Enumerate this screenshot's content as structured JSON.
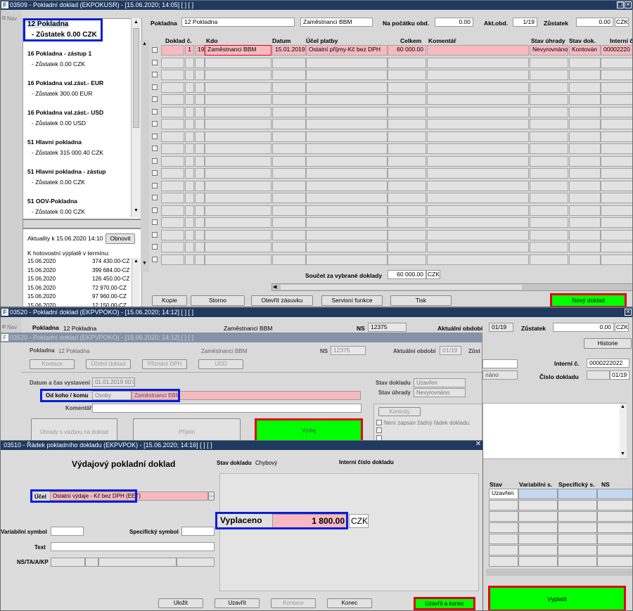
{
  "win1": {
    "title": "03509 - Pokladní doklad (EKPOKUSR) - [15.06.2020; 14:05]  [ ]  [ ]",
    "nav": "Nav",
    "pokladny": [
      {
        "name": "12 Pokladna",
        "balance": "- Zůstatek 0.00 CZK"
      },
      {
        "name": "16 Pokladna - zástup 1",
        "balance": "- Zůstatek 0.00 CZK"
      },
      {
        "name": "16 Pokladna val.zást.- EUR",
        "balance": "- Zůstatek 300.00 EUR"
      },
      {
        "name": "16 Pokladna val.zást.- USD",
        "balance": "- Zůstatek 0.00 USD"
      },
      {
        "name": "51 Hlavní pokladna",
        "balance": "- Zůstatek 315 000.40 CZK"
      },
      {
        "name": "51 Hlavní pokladna - zástup",
        "balance": "- Zůstatek 0.00 CZK"
      },
      {
        "name": "51 OOV-Pokladna",
        "balance": "- Zůstatek 0.00 CZK"
      }
    ],
    "aktuality": "Aktuality k 15.06.2020 14:10",
    "obnovit": "Obnovit",
    "vyplate_title": "K hotovostní výplatě v termínu:",
    "vyplate": [
      {
        "date": "15.06.2020",
        "amount": "374 430.00-CZ"
      },
      {
        "date": "15.06.2020",
        "amount": "399 684.00-CZ"
      },
      {
        "date": "15.06.2020",
        "amount": "126 450.00-CZ"
      },
      {
        "date": "15.06.2020",
        "amount": "72 970.00-CZ"
      },
      {
        "date": "15.06.2020",
        "amount": "97 960.00-CZ"
      },
      {
        "date": "15.06.2020",
        "amount": "12 150.00-CZ"
      }
    ],
    "top": {
      "pokladna_label": "Pokladna",
      "pokladna_value": "12 Pokladna",
      "zam_value": "Zaměstnanci BBM",
      "napoc_label": "Na počátku obd.",
      "napoc_value": "0.00",
      "aktobd_label": "Akt.obd.",
      "aktobd_value": "1/19",
      "zustatek_label": "Zůstatek",
      "zustatek_value": "0.00",
      "currency": "CZK"
    },
    "columns": [
      "Doklad č.",
      "Kdo",
      "Datum",
      "Účel platby",
      "Celkem",
      "Komentář",
      "Stav úhrady",
      "Stav dok.",
      "Interní č"
    ],
    "row": {
      "d1": "1",
      "d2": "19",
      "kdo": "Zaměstnanci BBM",
      "datum": "15.01.2019",
      "ucel": "Ostatní příjmy-Kč bez DPH",
      "celkem": "60 000.00",
      "komentar": "",
      "stav_uhrady": "Nevyrovnáno",
      "stav_dok": "Kontován",
      "interni": "00002220"
    },
    "soucet_label": "Součet za vybrané doklady",
    "soucet_value": "60 000.00",
    "soucet_currency": "CZK",
    "buttons": {
      "kopie": "Kopie",
      "storno": "Storno",
      "zasuvka": "Otevřít zásuvku",
      "servis": "Servisní funkce",
      "tisk": "Tisk",
      "novy": "Nový doklad"
    }
  },
  "win2": {
    "title": "03520 - Pokladní doklad (EKPVPOKO) - [15.06.2020; 14:12]  [ ]  [ ]",
    "nav": "Nav",
    "pokladna_label": "Pokladna",
    "pokladna_value": "12 Pokladna",
    "zam_value": "Zaměstnanci BBM",
    "ns_label": "NS",
    "ns_value": "12375",
    "akt_label": "Aktuální období",
    "akt_value": "01/19",
    "zustatek_label": "Zůstatek",
    "zustatek_value": "0.00",
    "currency": "CZK",
    "historie": "Historie",
    "interni_label": "Interní č.",
    "interni_value": "0000222022",
    "cislo_label": "Číslo dokladu",
    "cislo_value": "01/19",
    "grid_headers": [
      "Stav",
      "Variabilní s.",
      "Specifický s.",
      "NS"
    ],
    "grid_stav": "Uzavřen",
    "vyplatit": "Vyplatit"
  },
  "ghost": {
    "title": "03520 - Pokladní doklad (EKPVPOKO) - [15.06.2020; 14:12]  [ ]  [ ]",
    "pokladna_label": "Pokladna",
    "pokladna_value": "12 Pokladna",
    "zam_value": "Zaměstnanci BBM",
    "ns_label": "NS",
    "ns_value": "12375",
    "akt_label": "Aktuální období",
    "akt_value": "01/19",
    "zus_label": "Zůst",
    "tabs": [
      "Kontace",
      "Účetní doklad",
      "Přiznání DPH",
      "UDD"
    ],
    "datum_label": "Datum a čas vystavení",
    "datum_value": "01.01.2019 00:00",
    "odkoho_label": "Od koho / komu",
    "osoby": "Osoby",
    "odkoho_value": "Zaměstnanci BBM",
    "komentar_label": "Komentář",
    "stav_dokladu_label": "Stav dokladu",
    "stav_dokladu_value": "Uzavřen",
    "stav_uhrady_label": "Stav úhrady",
    "stav_uhrady_value": "Nevyrovnáno",
    "kontroly": "Kontroly",
    "kontroly_msg": "Není zapsán žádný řádek dokladu.",
    "uhrady_btn": "Úhrady s vazbou na doklad",
    "prijem_btn": "Příjem",
    "vydej_btn": "Výdej",
    "naro": "náno"
  },
  "win3": {
    "title": "03510 - Řádek pokladního dokladu (EKPVPOK) - [15.06.2020; 14:16]  [ ]  [ ]",
    "heading": "Výdajový pokladní doklad",
    "stav_label": "Stav dokladu",
    "stav_value": "Chybový",
    "interni_label": "Interní číslo dokladu",
    "ucel_label": "Účel",
    "ucel_value": "Ostatní výdaje - Kč bez DPH (EET)",
    "vyplaceno_label": "Vyplaceno",
    "vyplaceno_value": "1 800.00",
    "currency": "CZK",
    "vs_label": "Variabilní symbol",
    "ss_label": "Specifický symbol",
    "text_label": "Text",
    "ns_label": "NS/TA/A/KP",
    "buttons": {
      "ulozit": "Uložit",
      "uzavrit": "Uzavřít",
      "kontace": "Kontace",
      "konec": "Konec",
      "uzavrit_konec": "Uzavřít a konec"
    }
  }
}
